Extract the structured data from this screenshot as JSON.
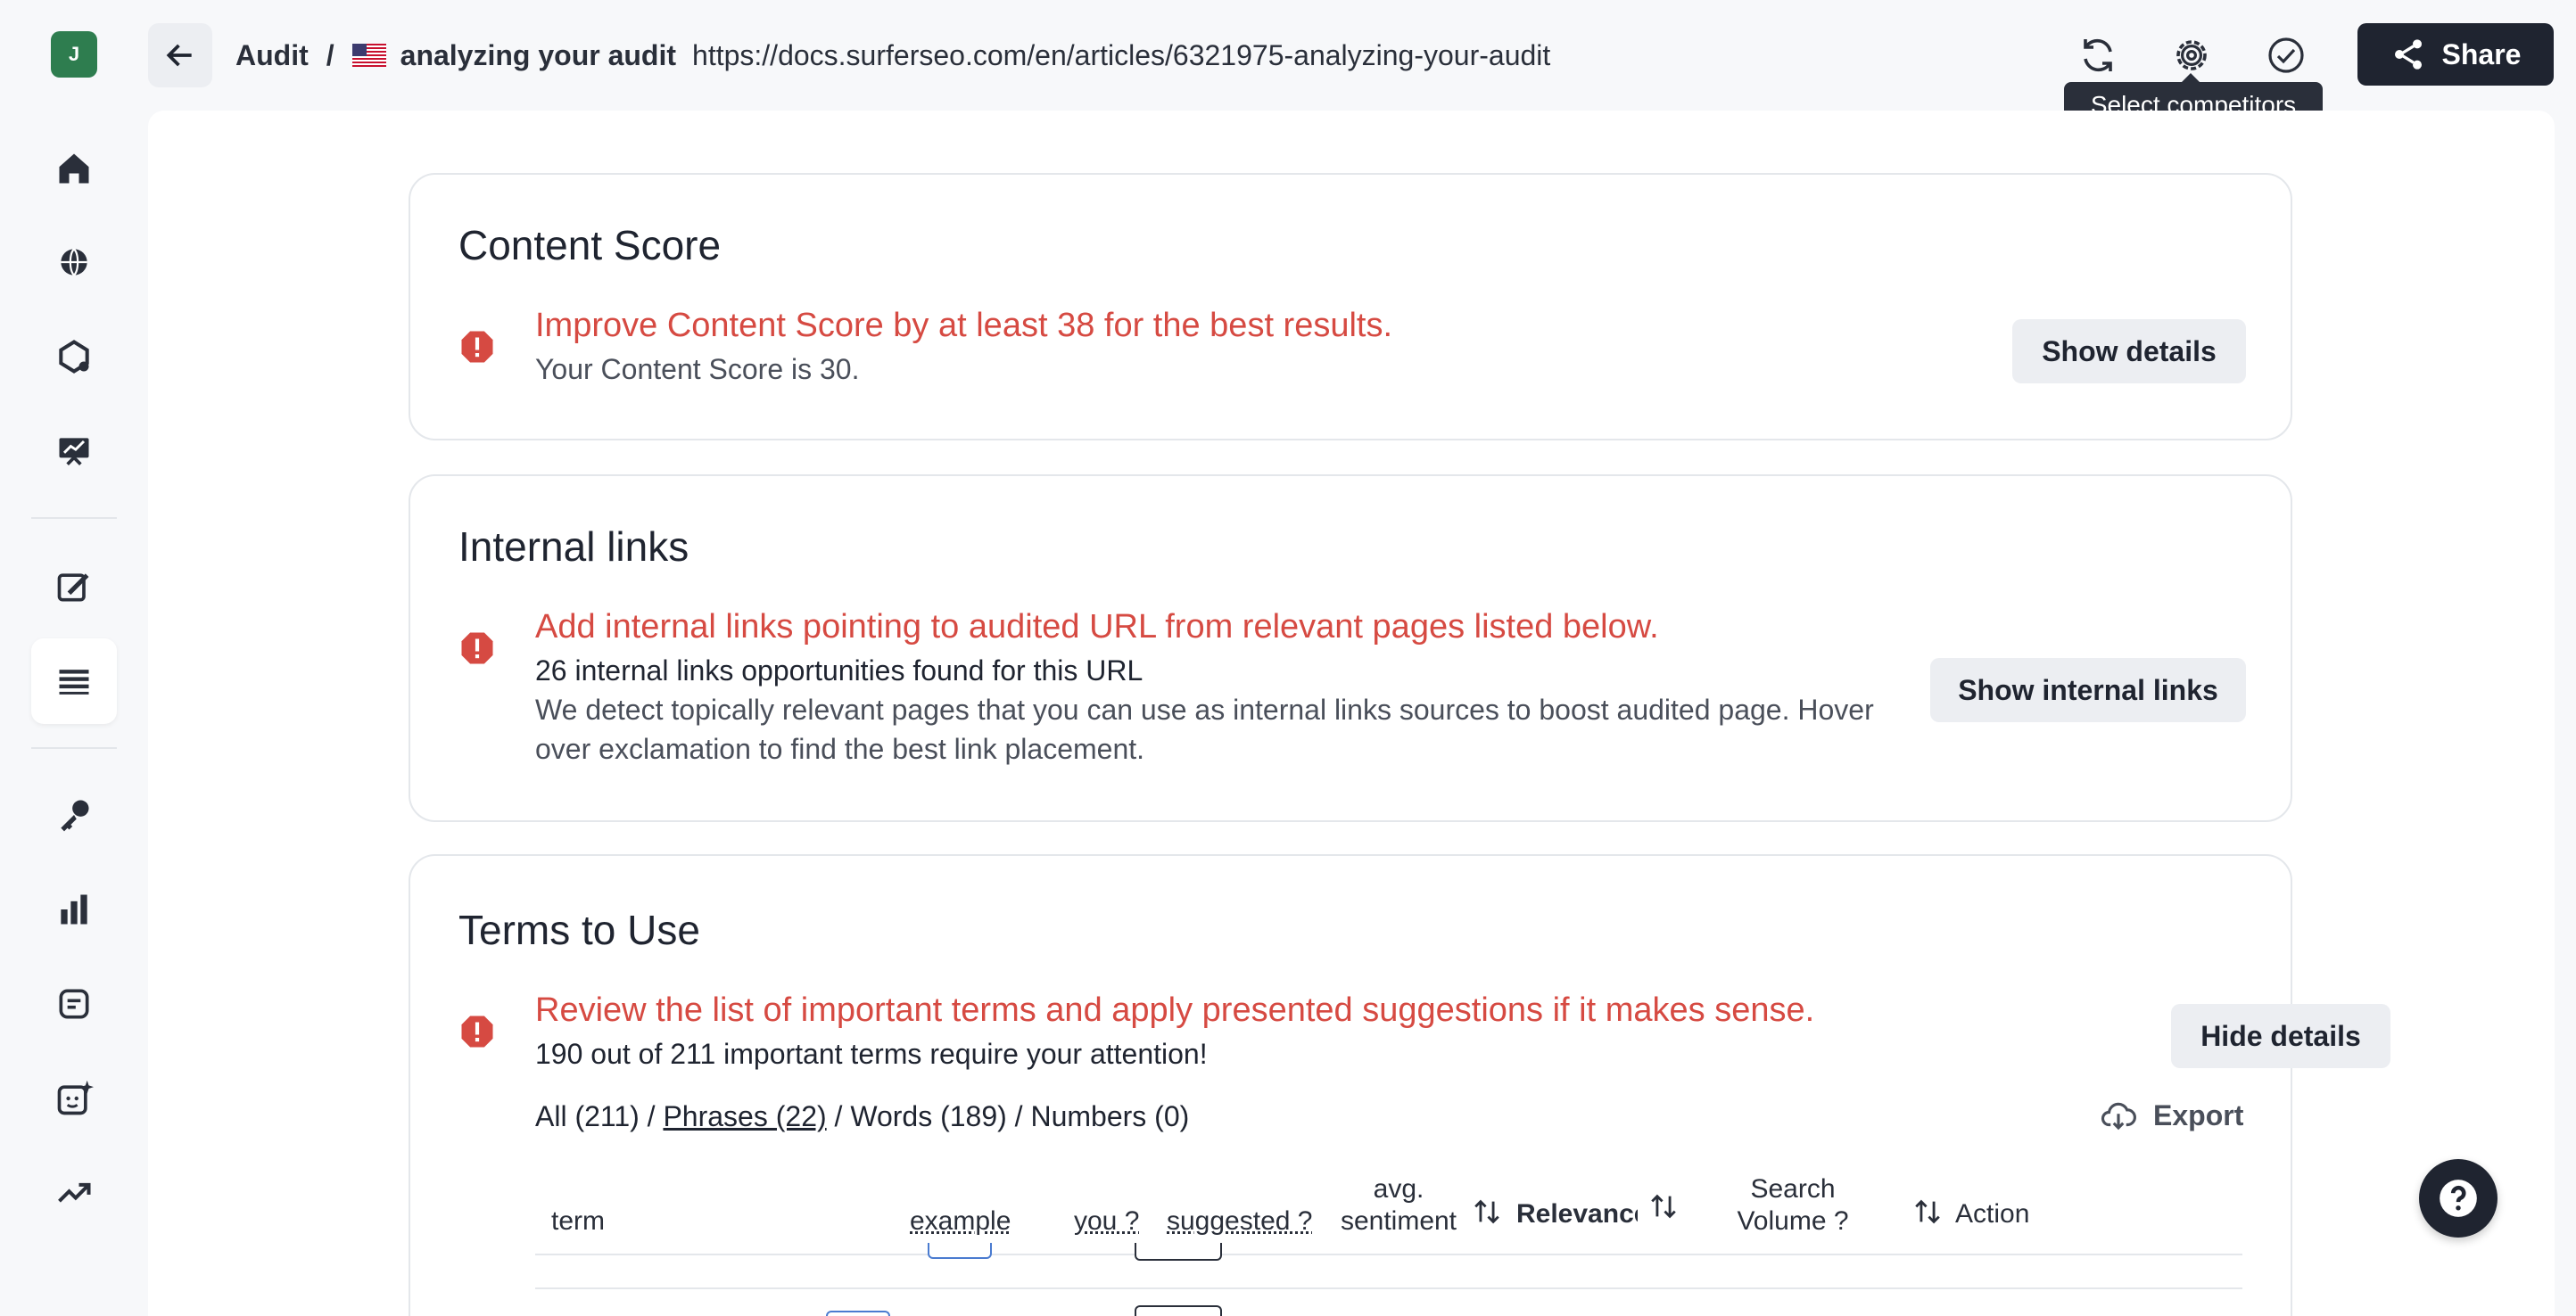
{
  "user": {
    "avatar_initial": "J"
  },
  "sidebar": {
    "items": [
      {
        "icon": "home-icon"
      },
      {
        "icon": "globe-icon"
      },
      {
        "icon": "plugin-icon"
      },
      {
        "icon": "presentation-chart-icon"
      },
      {
        "icon": "editor-icon"
      },
      {
        "icon": "audit-list-icon",
        "active": true
      },
      {
        "icon": "key-icon"
      },
      {
        "icon": "bar-chart-icon"
      },
      {
        "icon": "document-icon"
      },
      {
        "icon": "ai-sparkle-icon"
      },
      {
        "icon": "trending-icon"
      }
    ]
  },
  "header": {
    "breadcrumb_root": "Audit",
    "breadcrumb_separator": "/",
    "page_name": "analyzing your audit",
    "url": "https://docs.surferseo.com/en/articles/6321975-analyzing-your-audit",
    "share_label": "Share",
    "tooltip": "Select competitors"
  },
  "content_score": {
    "title": "Content Score",
    "alert": "Improve Content Score by at least 38 for the best results.",
    "detail": "Your Content Score is 30.",
    "button": "Show details"
  },
  "internal_links": {
    "title": "Internal links",
    "alert": "Add internal links pointing to audited URL from relevant pages listed below.",
    "detail": "26 internal links opportunities found for this URL",
    "description": "We detect topically relevant pages that you can use as internal links sources to boost audited page. Hover over exclamation to find the best link placement.",
    "button": "Show internal links"
  },
  "terms": {
    "title": "Terms to Use",
    "alert": "Review the list of important terms and apply presented suggestions if it makes sense.",
    "detail": "190 out of 211 important terms require your attention!",
    "button": "Hide details",
    "filters": {
      "all": "All (211)",
      "phrases": "Phrases (22)",
      "words": "Words (189)",
      "numbers": "Numbers (0)",
      "sep": " / "
    },
    "export": "Export",
    "columns": {
      "term": "term",
      "example": "example",
      "you": "you ?",
      "suggested": "suggested ?",
      "avg_line1": "avg.",
      "avg_line2": "sentiment",
      "relevance": "Relevance",
      "search_line1": "Search",
      "search_line2": "Volume ?",
      "action": "Action"
    }
  },
  "colors": {
    "alert_red": "#d64a42",
    "dark": "#1f2430",
    "avatar_green": "#2e7d4f"
  }
}
